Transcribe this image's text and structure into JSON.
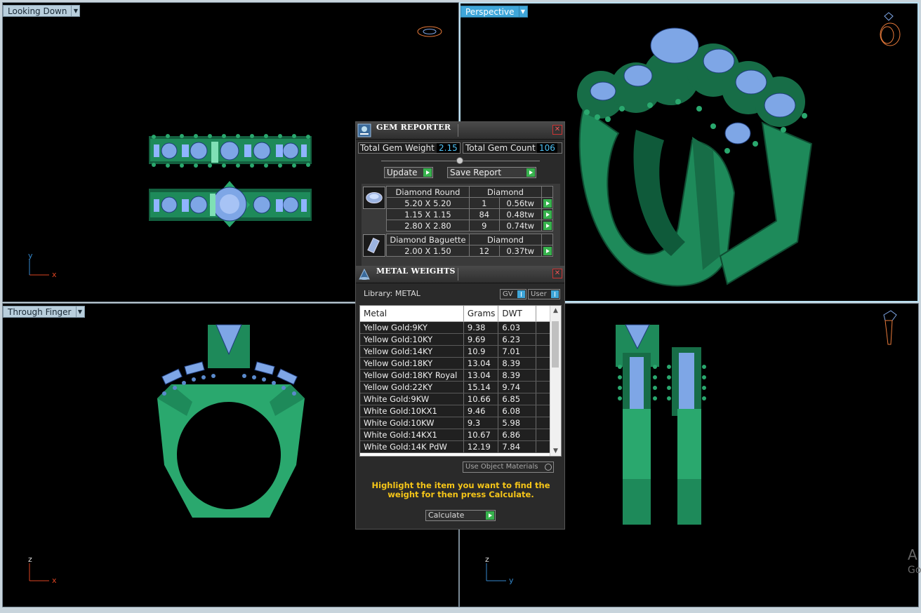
{
  "viewports": {
    "top_left": {
      "label": "Looking Down",
      "axis1": "y",
      "axis2": "x"
    },
    "top_right": {
      "label": "Perspective"
    },
    "bottom_left": {
      "label": "Through Finger",
      "axis1": "z",
      "axis2": "x"
    },
    "bottom_right": {
      "axis1": "z",
      "axis2": "y"
    }
  },
  "gem_reporter": {
    "title": "GEM REPORTER",
    "total_weight_label": "Total Gem Weight",
    "total_weight_value": "2.15",
    "total_count_label": "Total Gem Count",
    "total_count_value": "106",
    "update_label": "Update",
    "save_label": "Save Report",
    "groups": [
      {
        "shape": "Diamond Round",
        "type": "Diamond",
        "rows": [
          {
            "size": "5.20 X 5.20",
            "count": "1",
            "weight": "0.56tw"
          },
          {
            "size": "1.15 X 1.15",
            "count": "84",
            "weight": "0.48tw"
          },
          {
            "size": "2.80 X 2.80",
            "count": "9",
            "weight": "0.74tw"
          }
        ]
      },
      {
        "shape": "Diamond Baguette",
        "type": "Diamond",
        "rows": [
          {
            "size": "2.00 X 1.50",
            "count": "12",
            "weight": "0.37tw"
          }
        ]
      }
    ]
  },
  "metal_weights": {
    "title": "METAL WEIGHTS",
    "library_label": "Library: METAL",
    "gv_label": "GV",
    "user_label": "User",
    "columns": [
      "Metal",
      "Grams",
      "DWT"
    ],
    "rows": [
      {
        "metal": "Yellow Gold:9KY",
        "grams": "9.38",
        "dwt": "6.03"
      },
      {
        "metal": "Yellow Gold:10KY",
        "grams": "9.69",
        "dwt": "6.23"
      },
      {
        "metal": "Yellow Gold:14KY",
        "grams": "10.9",
        "dwt": "7.01"
      },
      {
        "metal": "Yellow Gold:18KY",
        "grams": "13.04",
        "dwt": "8.39"
      },
      {
        "metal": "Yellow Gold:18KY Royal",
        "grams": "13.04",
        "dwt": "8.39"
      },
      {
        "metal": "Yellow Gold:22KY",
        "grams": "15.14",
        "dwt": "9.74"
      },
      {
        "metal": "White Gold:9KW",
        "grams": "10.66",
        "dwt": "6.85"
      },
      {
        "metal": "White Gold:10KX1",
        "grams": "9.46",
        "dwt": "6.08"
      },
      {
        "metal": "White Gold:10KW",
        "grams": "9.3",
        "dwt": "5.98"
      },
      {
        "metal": "White Gold:14KX1",
        "grams": "10.67",
        "dwt": "6.86"
      },
      {
        "metal": "White Gold:14K PdW",
        "grams": "12.19",
        "dwt": "7.84"
      }
    ],
    "use_object_label": "Use Object Materials",
    "hint": "Highlight the item you want to find the weight for then press Calculate.",
    "calculate_label": "Calculate"
  },
  "watermark": {
    "line1": "A",
    "line2": "Go"
  },
  "colors": {
    "metal": "#1e8a5a",
    "metal_light": "#3fc38a",
    "gem": "#7ea6e6",
    "accent": "#3fa6d9"
  }
}
